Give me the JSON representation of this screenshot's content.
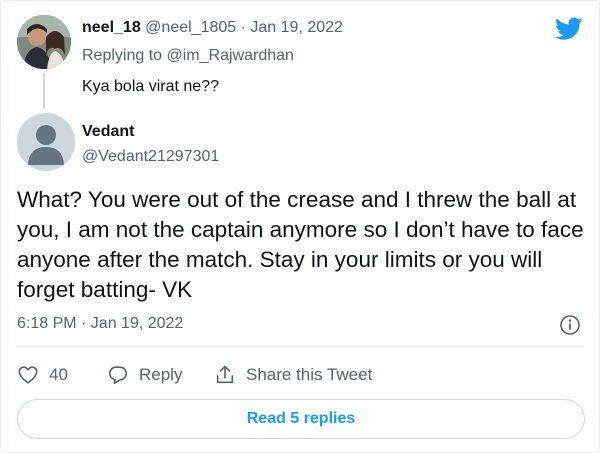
{
  "colors": {
    "accent": "#1d9bf0",
    "muted": "#536471",
    "text": "#0f1419",
    "border": "#e6ecf0"
  },
  "parent_tweet": {
    "name": "neel_18",
    "handle": "@neel_1805",
    "separator": "·",
    "date": "Jan 19, 2022",
    "replying_prefix": "Replying to",
    "replying_handle": "@im_Rajwardhan",
    "text": "Kya bola virat ne??",
    "avatar_icon": "profile-photo"
  },
  "main_tweet": {
    "name": "Vedant",
    "handle": "@Vedant21297301",
    "avatar_icon": "default-profile-icon",
    "text": "What? You were out of the crease and I threw the ball at you, I am not the captain anymore so I don’t have to face anyone after the match. Stay in your limits or you will forget batting- VK",
    "timestamp": "6:18 PM · Jan 19, 2022"
  },
  "actions": {
    "like_icon": "heart-icon",
    "like_count": "40",
    "reply_icon": "reply-bubble-icon",
    "reply_label": "Reply",
    "share_icon": "share-icon",
    "share_label": "Share this Tweet"
  },
  "footer": {
    "read_replies_label": "Read 5 replies"
  },
  "brand_icon": "twitter-bird-icon",
  "info_icon": "info-icon"
}
